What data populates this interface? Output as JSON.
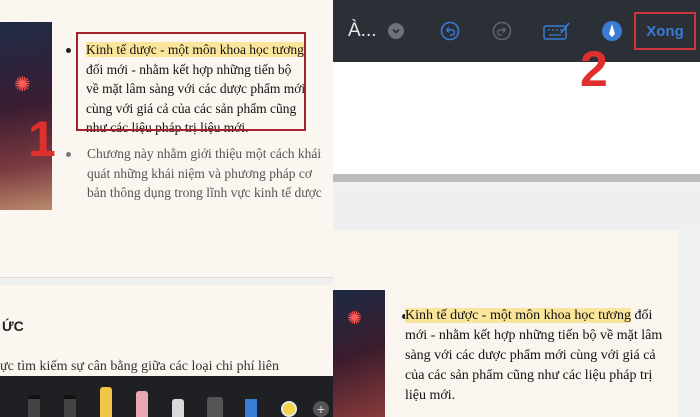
{
  "topbar": {
    "title": "À...",
    "done_label": "Xong"
  },
  "document": {
    "paragraph1_highlight": "Kinh tế dược - một môn khoa học tương",
    "paragraph1_rest": "đối mới - nhằm kết hợp những tiến bộ về mặt lâm sàng với các dược phẩm mới cùng với giá cả của các sản phẩm cũng như các liệu pháp trị liệu mới.",
    "paragraph2": "Chương này nhằm giới thiệu một cách khái quát những khái niệm và phương pháp cơ bản thông dụng trong lĩnh vực kinh tế dược",
    "section_heading": "ỨC",
    "section_line": "ực tìm kiếm sự cân bằng giữa các loại chi phí liên"
  },
  "steps": {
    "one": "1",
    "two": "2"
  },
  "icons": [
    "chevron-down-icon",
    "undo-icon",
    "redo-icon",
    "keyboard-pencil-icon",
    "markup-pen-icon",
    "plus-icon"
  ],
  "colors": {
    "highlight": "#fbe59b",
    "step_red": "#e0302e",
    "done_blue": "#3a7bd5",
    "topbar": "#2b2f36"
  }
}
